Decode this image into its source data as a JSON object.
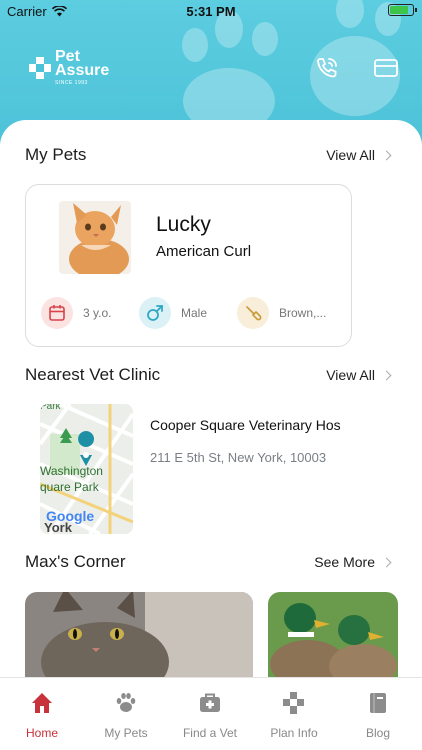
{
  "status_bar": {
    "carrier": "Carrier",
    "time": "5:31 PM"
  },
  "header": {
    "logo_line1": "Pet",
    "logo_line2": "Assure",
    "logo_since": "SINCE 1993",
    "icons": [
      "phone-icon",
      "card-icon"
    ]
  },
  "my_pets": {
    "title": "My Pets",
    "view_all": "View All",
    "pet": {
      "name": "Lucky",
      "breed": "American Curl",
      "age": "3 y.o.",
      "gender": "Male",
      "color": "Brown,..."
    }
  },
  "clinic": {
    "title": "Nearest Vet Clinic",
    "view_all": "View All",
    "name": "Cooper Square Veterinary Hos",
    "address": "211 E 5th St, New York, 10003",
    "map_labels": {
      "park_top": "Park",
      "park_1": "Washington",
      "park_2": "quare Park",
      "google": "Google",
      "city": "York"
    }
  },
  "corner": {
    "title": "Max's Corner",
    "see_more": "See More"
  },
  "tabs": [
    {
      "label": "Home",
      "icon": "home-icon",
      "active": true
    },
    {
      "label": "My Pets",
      "icon": "paw-icon",
      "active": false
    },
    {
      "label": "Find a Vet",
      "icon": "medical-kit-icon",
      "active": false
    },
    {
      "label": "Plan Info",
      "icon": "plan-cross-icon",
      "active": false
    },
    {
      "label": "Blog",
      "icon": "book-icon",
      "active": false
    }
  ],
  "colors": {
    "accent": "#c8323a",
    "header": "#55c8dd",
    "inactive": "#888888"
  }
}
